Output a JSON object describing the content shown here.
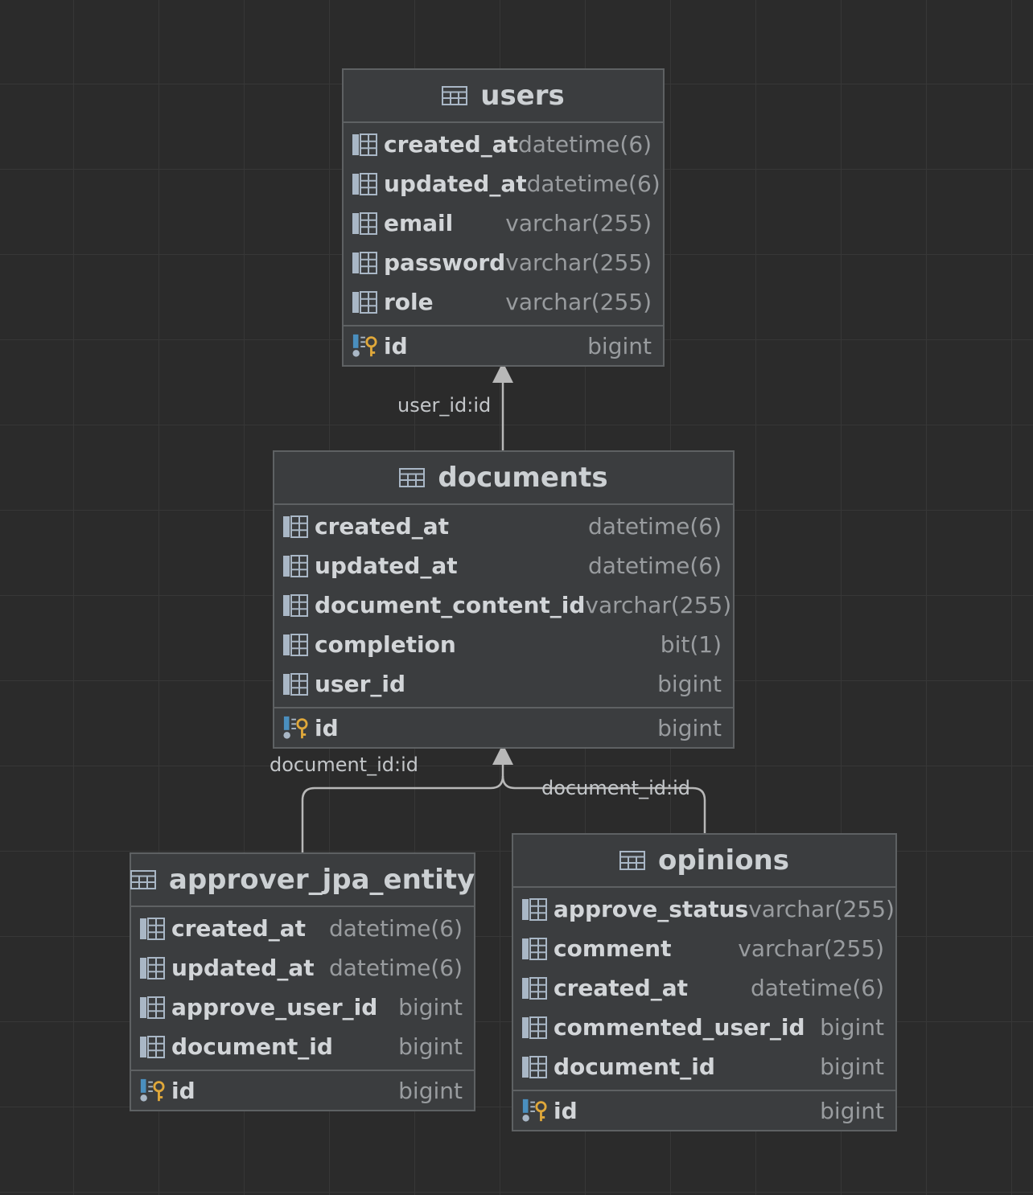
{
  "entities": {
    "users": {
      "name": "users",
      "columns": [
        {
          "name": "created_at",
          "type": "datetime(6)"
        },
        {
          "name": "updated_at",
          "type": "datetime(6)"
        },
        {
          "name": "email",
          "type": "varchar(255)"
        },
        {
          "name": "password",
          "type": "varchar(255)"
        },
        {
          "name": "role",
          "type": "varchar(255)"
        }
      ],
      "pk": {
        "name": "id",
        "type": "bigint"
      }
    },
    "documents": {
      "name": "documents",
      "columns": [
        {
          "name": "created_at",
          "type": "datetime(6)"
        },
        {
          "name": "updated_at",
          "type": "datetime(6)"
        },
        {
          "name": "document_content_id",
          "type": "varchar(255)"
        },
        {
          "name": "completion",
          "type": "bit(1)"
        },
        {
          "name": "user_id",
          "type": "bigint"
        }
      ],
      "pk": {
        "name": "id",
        "type": "bigint"
      }
    },
    "approver": {
      "name": "approver_jpa_entity",
      "columns": [
        {
          "name": "created_at",
          "type": "datetime(6)"
        },
        {
          "name": "updated_at",
          "type": "datetime(6)"
        },
        {
          "name": "approve_user_id",
          "type": "bigint"
        },
        {
          "name": "document_id",
          "type": "bigint"
        }
      ],
      "pk": {
        "name": "id",
        "type": "bigint"
      }
    },
    "opinions": {
      "name": "opinions",
      "columns": [
        {
          "name": "approve_status",
          "type": "varchar(255)"
        },
        {
          "name": "comment",
          "type": "varchar(255)"
        },
        {
          "name": "created_at",
          "type": "datetime(6)"
        },
        {
          "name": "commented_user_id",
          "type": "bigint"
        },
        {
          "name": "document_id",
          "type": "bigint"
        }
      ],
      "pk": {
        "name": "id",
        "type": "bigint"
      }
    }
  },
  "relations": [
    {
      "label": "user_id:id"
    },
    {
      "label": "document_id:id"
    },
    {
      "label": "document_id:id"
    }
  ],
  "icons": {
    "table": "table-icon",
    "column": "column-icon",
    "primary_key": "primary-key-icon"
  },
  "colors": {
    "background": "#2b2b2b",
    "entity_fill": "#3b3d3f",
    "border": "#5e6163",
    "key": "#e0a83a",
    "edge": "#b8b8b8"
  }
}
